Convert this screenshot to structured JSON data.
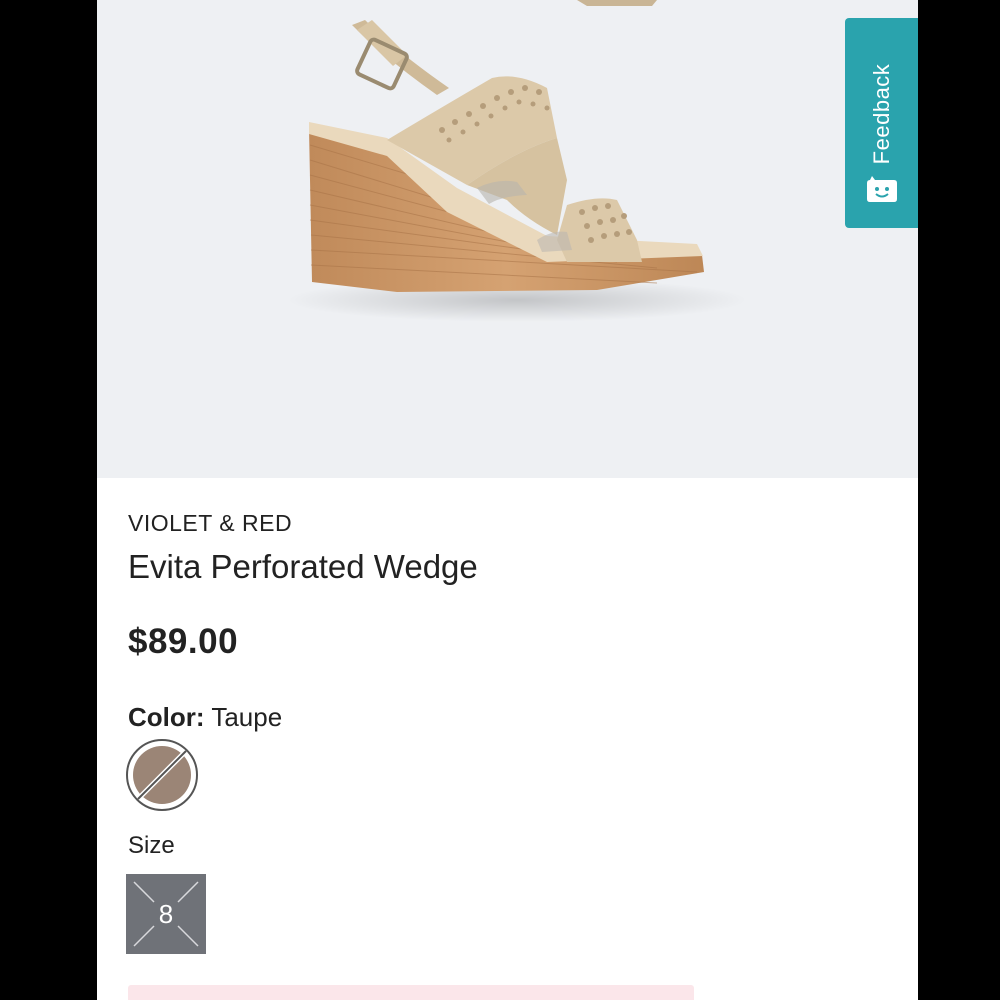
{
  "product": {
    "brand": "VIOLET & RED",
    "name": "Evita Perforated Wedge",
    "price": "$89.00",
    "color_label": "Color:",
    "color_value": "Taupe",
    "size_label": "Size",
    "sizes": [
      "8"
    ]
  },
  "feedback": {
    "label": "Feedback"
  },
  "alert": {
    "text": ""
  },
  "colors": {
    "accent": "#2aa3ad",
    "swatch_taupe": "#9b8576",
    "size_box": "#6f7278",
    "alert_bg": "#fbe6ea"
  },
  "icons": {
    "feedback": "smiley-chat-icon",
    "swatch": "unavailable-swatch-icon",
    "size": "unavailable-size-icon"
  }
}
